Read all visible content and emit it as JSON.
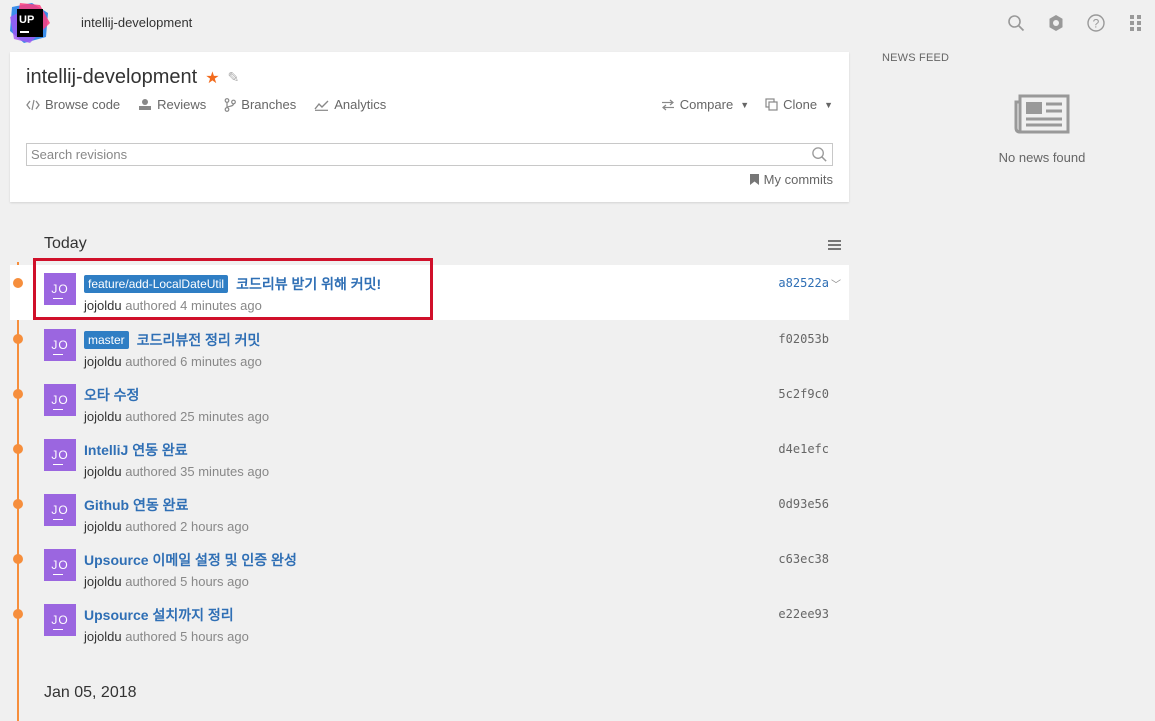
{
  "header": {
    "logo_text": "UP",
    "title": "intellij-development",
    "icons": [
      "search-icon",
      "settings-icon",
      "help-icon",
      "apps-grid-icon"
    ]
  },
  "project": {
    "name": "intellij-development",
    "nav": [
      {
        "label": "Browse code",
        "icon": "code-icon"
      },
      {
        "label": "Reviews",
        "icon": "reviews-icon"
      },
      {
        "label": "Branches",
        "icon": "branch-icon"
      },
      {
        "label": "Analytics",
        "icon": "analytics-icon"
      }
    ],
    "compare_label": "Compare",
    "clone_label": "Clone",
    "search_placeholder": "Search revisions",
    "my_commits_label": "My commits"
  },
  "news": {
    "label": "NEWS FEED",
    "empty_text": "No news found"
  },
  "timeline": {
    "today_label": "Today",
    "next_date_label": "Jan 05, 2018",
    "commits": [
      {
        "branch": "feature/add-LocalDateUtil",
        "message": "코드리뷰 받기 위해 커밋!",
        "author": "jojoldu",
        "time": "authored 4 minutes ago",
        "hash": "a82522a",
        "avatar": "JO"
      },
      {
        "branch": "master",
        "message": "코드리뷰전 정리 커밋",
        "author": "jojoldu",
        "time": "authored 6 minutes ago",
        "hash": "f02053b",
        "avatar": "JO"
      },
      {
        "branch": "",
        "message": "오타 수정",
        "author": "jojoldu",
        "time": "authored 25 minutes ago",
        "hash": "5c2f9c0",
        "avatar": "JO"
      },
      {
        "branch": "",
        "message": "IntelliJ 연동 완료",
        "author": "jojoldu",
        "time": "authored 35 minutes ago",
        "hash": "d4e1efc",
        "avatar": "JO"
      },
      {
        "branch": "",
        "message": "Github 연동 완료",
        "author": "jojoldu",
        "time": "authored 2 hours ago",
        "hash": "0d93e56",
        "avatar": "JO"
      },
      {
        "branch": "",
        "message": "Upsource 이메일 설정 및 인증 완성",
        "author": "jojoldu",
        "time": "authored 5 hours ago",
        "hash": "c63ec38",
        "avatar": "JO"
      },
      {
        "branch": "",
        "message": "Upsource 설치까지 정리",
        "author": "jojoldu",
        "time": "authored 5 hours ago",
        "hash": "e22ee93",
        "avatar": "JO"
      }
    ]
  },
  "colors": {
    "accent": "#f68e3c",
    "link": "#2f6fb5",
    "branch_badge": "#2f7ec4",
    "avatar": "#9b66e0",
    "highlight_border": "#d0102a"
  }
}
